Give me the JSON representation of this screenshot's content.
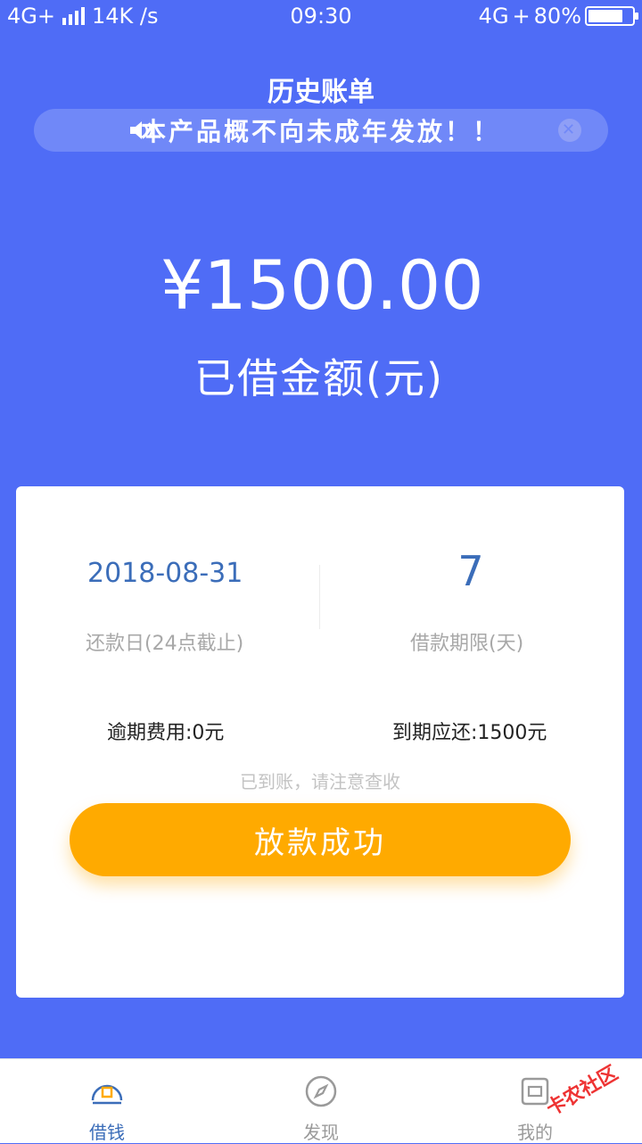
{
  "status_bar": {
    "network_left": "4G+",
    "speed": "14K /s",
    "time": "09:30",
    "network_right": "4G",
    "battery": "80%",
    "battery_level": 0.8
  },
  "header": {
    "title": "历史账单"
  },
  "notice": {
    "text": "本产品概不向未成年发放！！"
  },
  "loan": {
    "amount": "¥1500.00",
    "amount_label": "已借金额(元)"
  },
  "card": {
    "due_date": "2018-08-31",
    "due_date_label": "还款日(24点截止)",
    "term_value": "7",
    "term_label": "借款期限(天)",
    "overdue_fee": "逾期费用:0元",
    "due_amount": "到期应还:1500元",
    "arrival_hint": "已到账，请注意查收",
    "status_button": "放款成功"
  },
  "tabs": [
    {
      "label": "借钱",
      "icon": "borrow-icon",
      "active": true
    },
    {
      "label": "发现",
      "icon": "compass-icon",
      "active": false
    },
    {
      "label": "我的",
      "icon": "profile-icon",
      "active": false
    }
  ],
  "watermark": {
    "text": "卡农社区"
  },
  "colors": {
    "background": "#4f6cf6",
    "accent_blue": "#3b6db9",
    "button_orange": "#ffaa00"
  }
}
